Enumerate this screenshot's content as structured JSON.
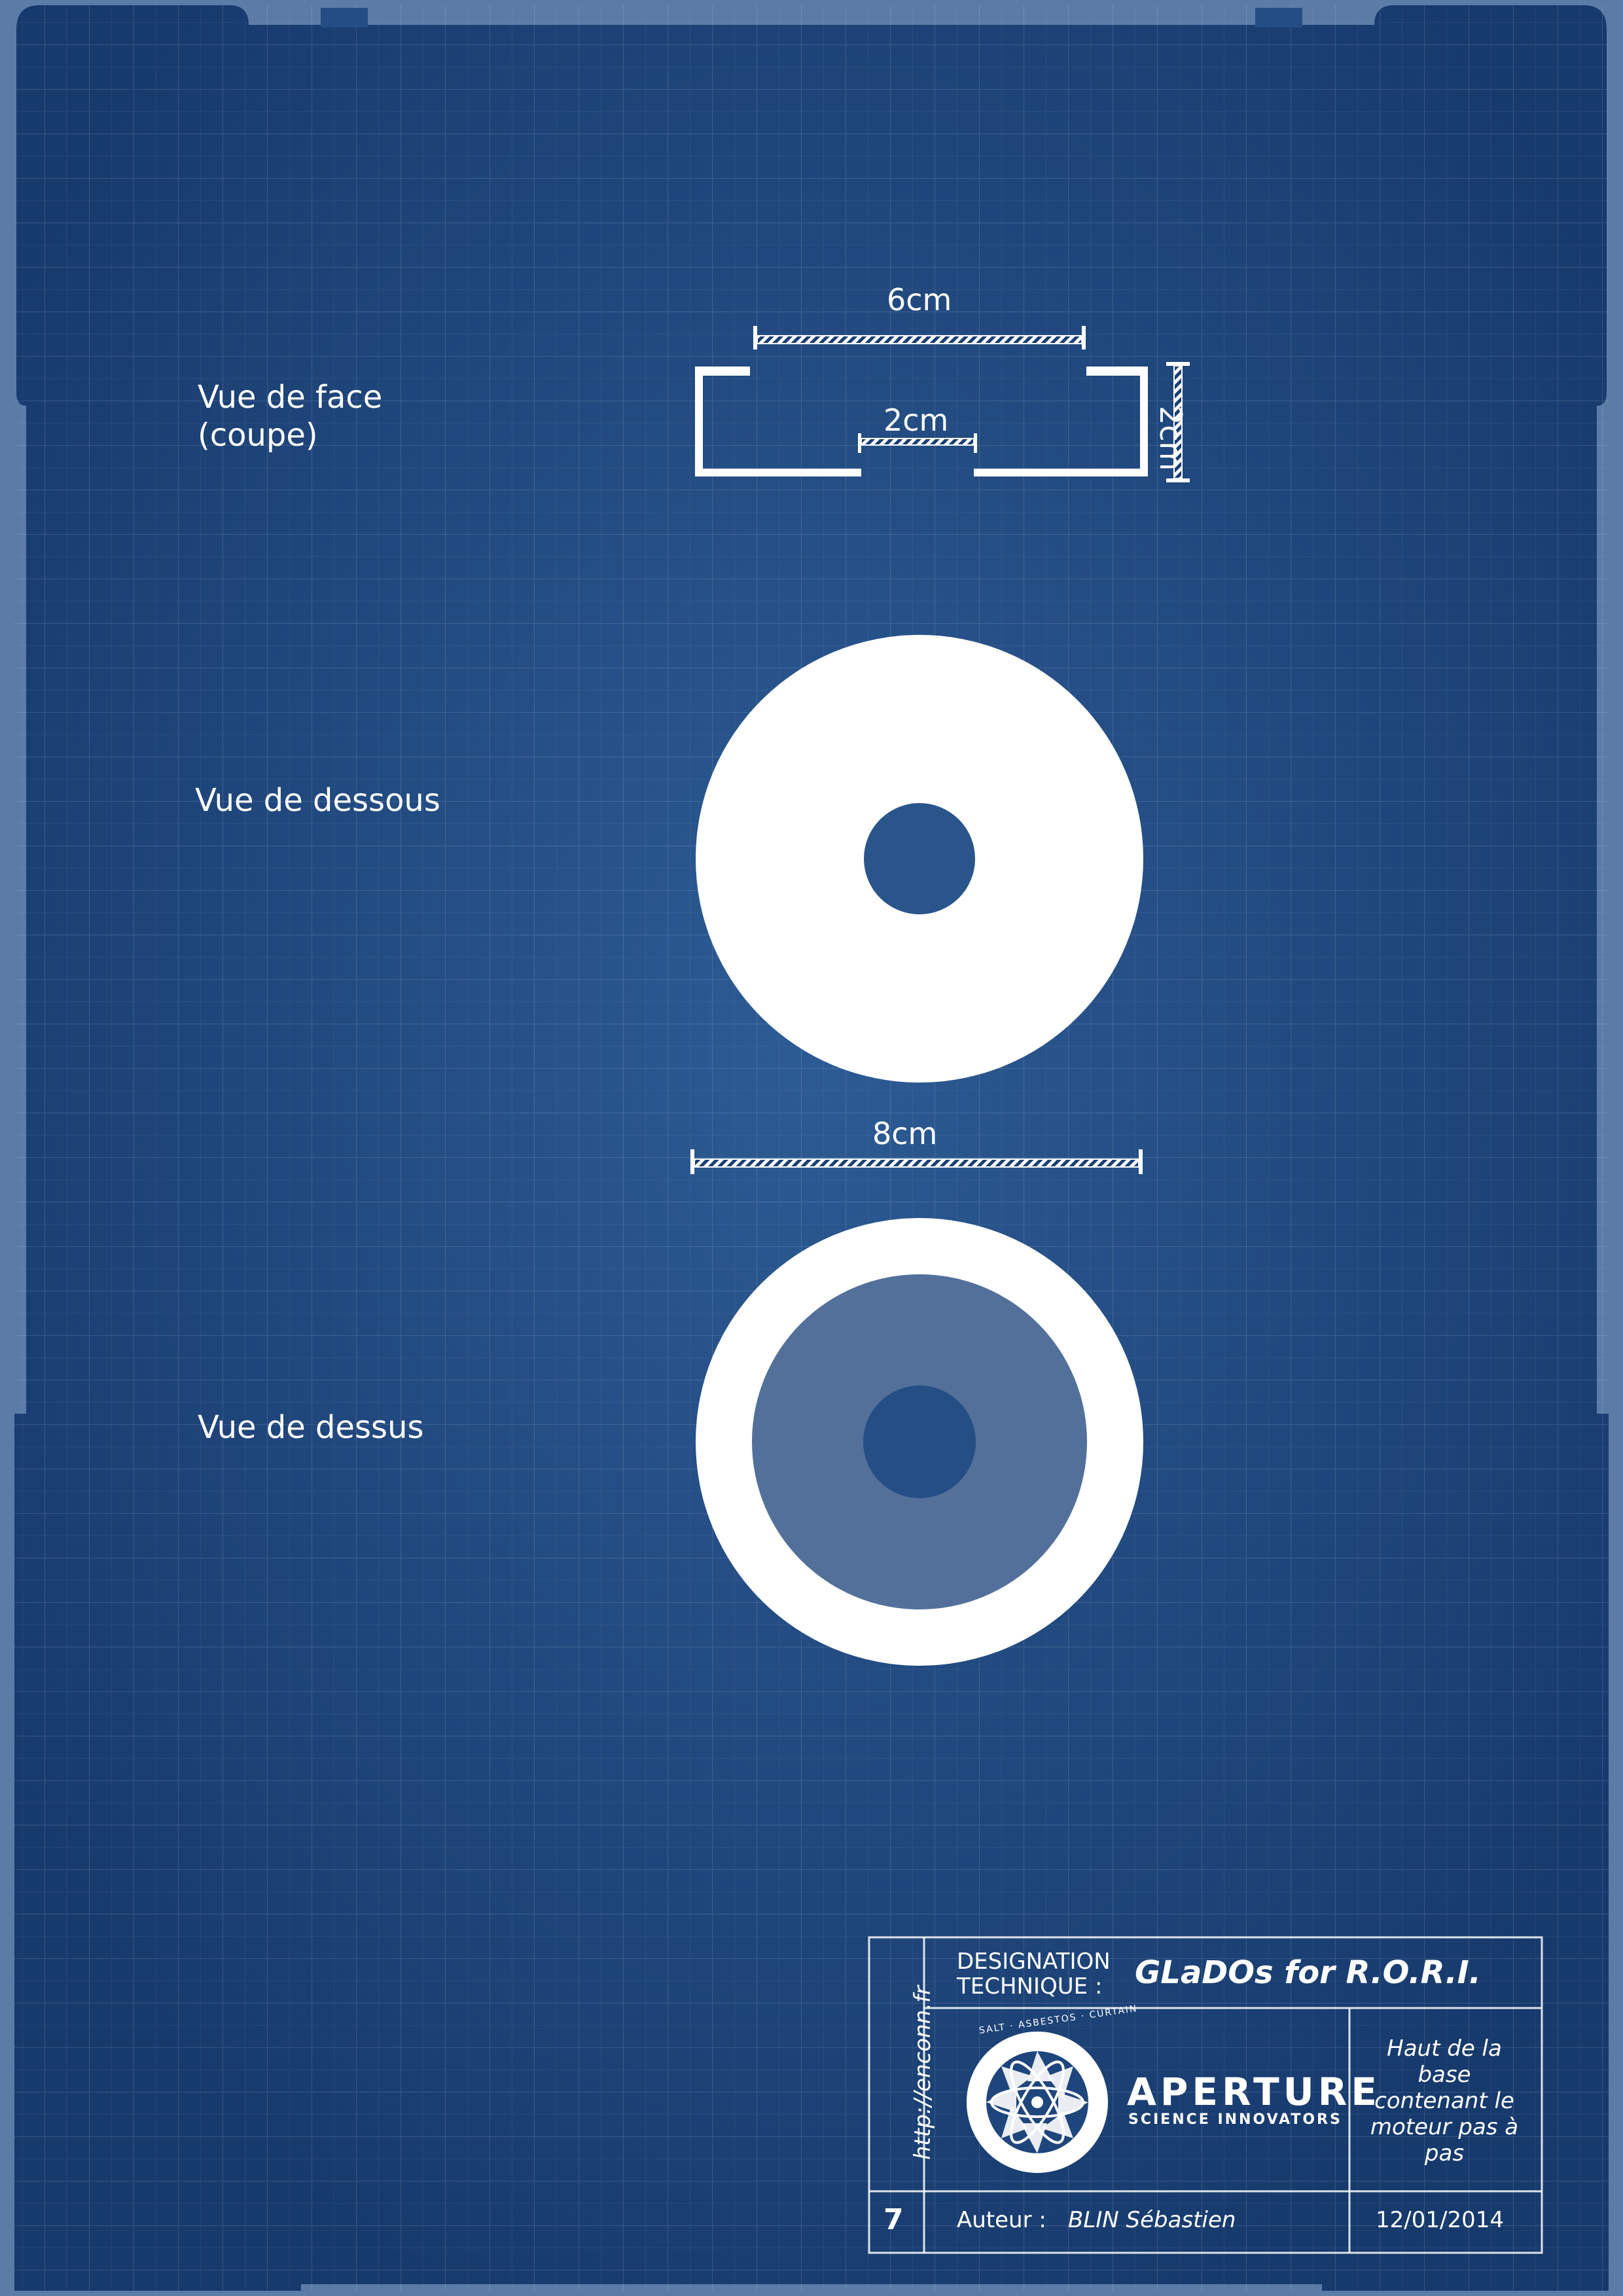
{
  "views": {
    "front_label_line1": "Vue de face",
    "front_label_line2": "(coupe)",
    "bottom_label": "Vue de dessous",
    "top_label": "Vue de dessus"
  },
  "dimensions": {
    "outer_width": "6cm",
    "inner_gap": "2cm",
    "height": "2cm",
    "diameter": "8cm"
  },
  "title_block": {
    "url": "http://enconn.fr",
    "designation_line1": "DESIGNATION",
    "designation_line2": "TECHNIQUE  :",
    "project_title": "GLaDOs for R.O.R.I.",
    "logo_name": "APERTURE",
    "logo_tagline": "SCIENCE INNOVATORS",
    "logo_ring_text": "SALT · ASBESTOS · CURTAIN",
    "part_description_lines": [
      "Haut de la",
      "base",
      "contenant le",
      "moteur pas à",
      "pas"
    ],
    "page_number": "7",
    "author_label": "Auteur :",
    "author_name": "BLIN Sébastien",
    "date": "12/01/2014"
  },
  "colors": {
    "background": "#1a3f74",
    "ink": "#ffffff",
    "ring_fill": "#52709a"
  },
  "icons": {
    "logo": "aperture-logo-icon"
  }
}
